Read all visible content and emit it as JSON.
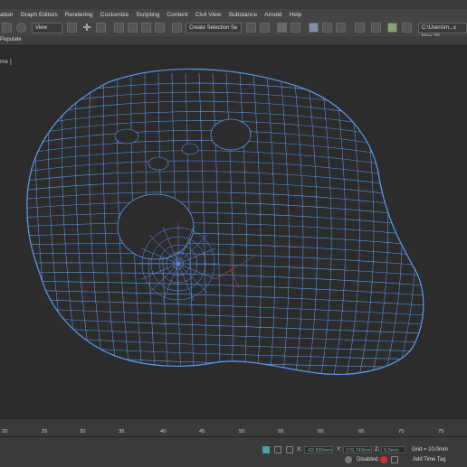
{
  "menu": [
    "ation",
    "Graph Editors",
    "Rendering",
    "Customize",
    "Scripting",
    "Content",
    "Civil View",
    "Substance",
    "Arnold",
    "Help"
  ],
  "toolbar": {
    "view_dropdown": "View",
    "selection_set": "Create Selection Se",
    "path_field": "C:\\Users\\m...x Max 20"
  },
  "subbar": {
    "populate": "Populate"
  },
  "viewport": {
    "label": "me ]"
  },
  "timeline": {
    "ticks": [
      "20",
      "25",
      "30",
      "35",
      "40",
      "45",
      "50",
      "55",
      "60",
      "65",
      "70",
      "75"
    ]
  },
  "status": {
    "x_label": "X:",
    "x_value": "-62,939mm",
    "y_label": "Y:",
    "y_value": "176,743mm",
    "z_label": "Z:",
    "z_value": "0,0mm",
    "grid": "Grid = 10,0mm",
    "disabled": "Disabled:",
    "add_time_tag": "Add Time Tag"
  },
  "colors": {
    "wire": "#5b9bf0",
    "background": "#2c2c2c",
    "bar": "#444444"
  }
}
